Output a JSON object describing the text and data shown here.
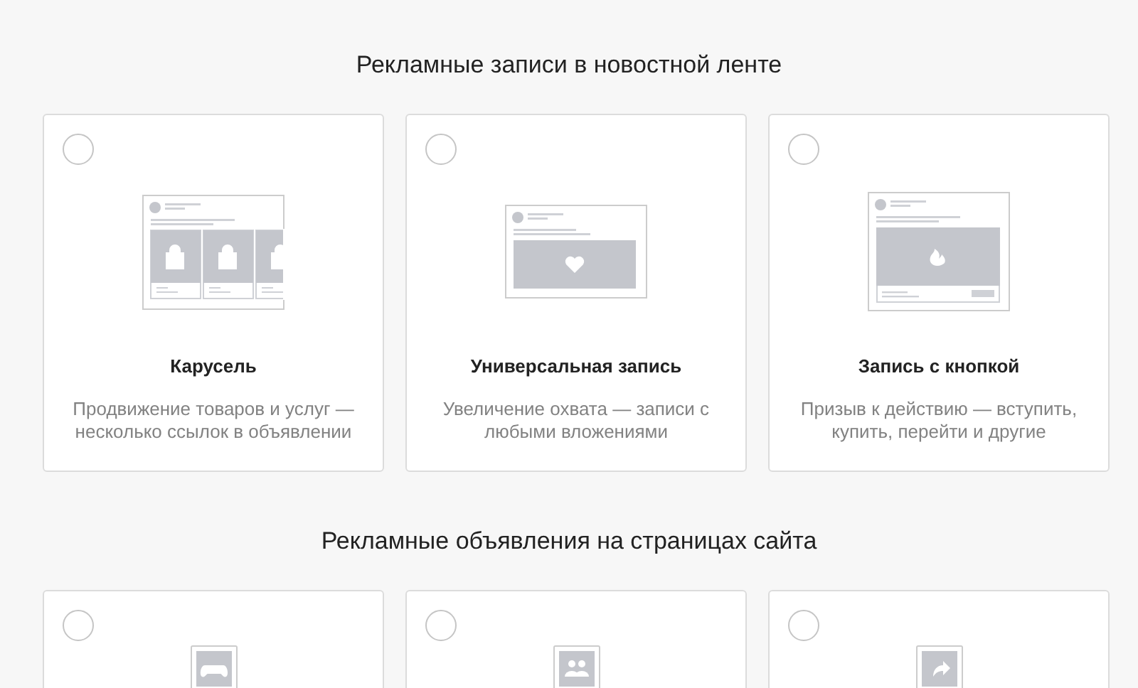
{
  "sections": [
    {
      "title": "Рекламные записи в новостной ленте",
      "cards": [
        {
          "kind": "carousel",
          "title": "Карусель",
          "description": "Продвижение товаров и услуг — несколько ссылок в объявлении",
          "selected": false
        },
        {
          "kind": "universal",
          "title": "Универсальная запись",
          "description": "Увеличение охвата — записи с любыми вложениями",
          "selected": false
        },
        {
          "kind": "button",
          "title": "Запись с кнопкой",
          "description": "Призыв к действию — вступить, купить, перейти и другие",
          "selected": false
        }
      ]
    },
    {
      "title": "Рекламные объявления на страницах сайта",
      "cards": [
        {
          "kind": "game",
          "selected": false
        },
        {
          "kind": "community",
          "selected": false
        },
        {
          "kind": "link",
          "selected": false
        }
      ]
    }
  ]
}
